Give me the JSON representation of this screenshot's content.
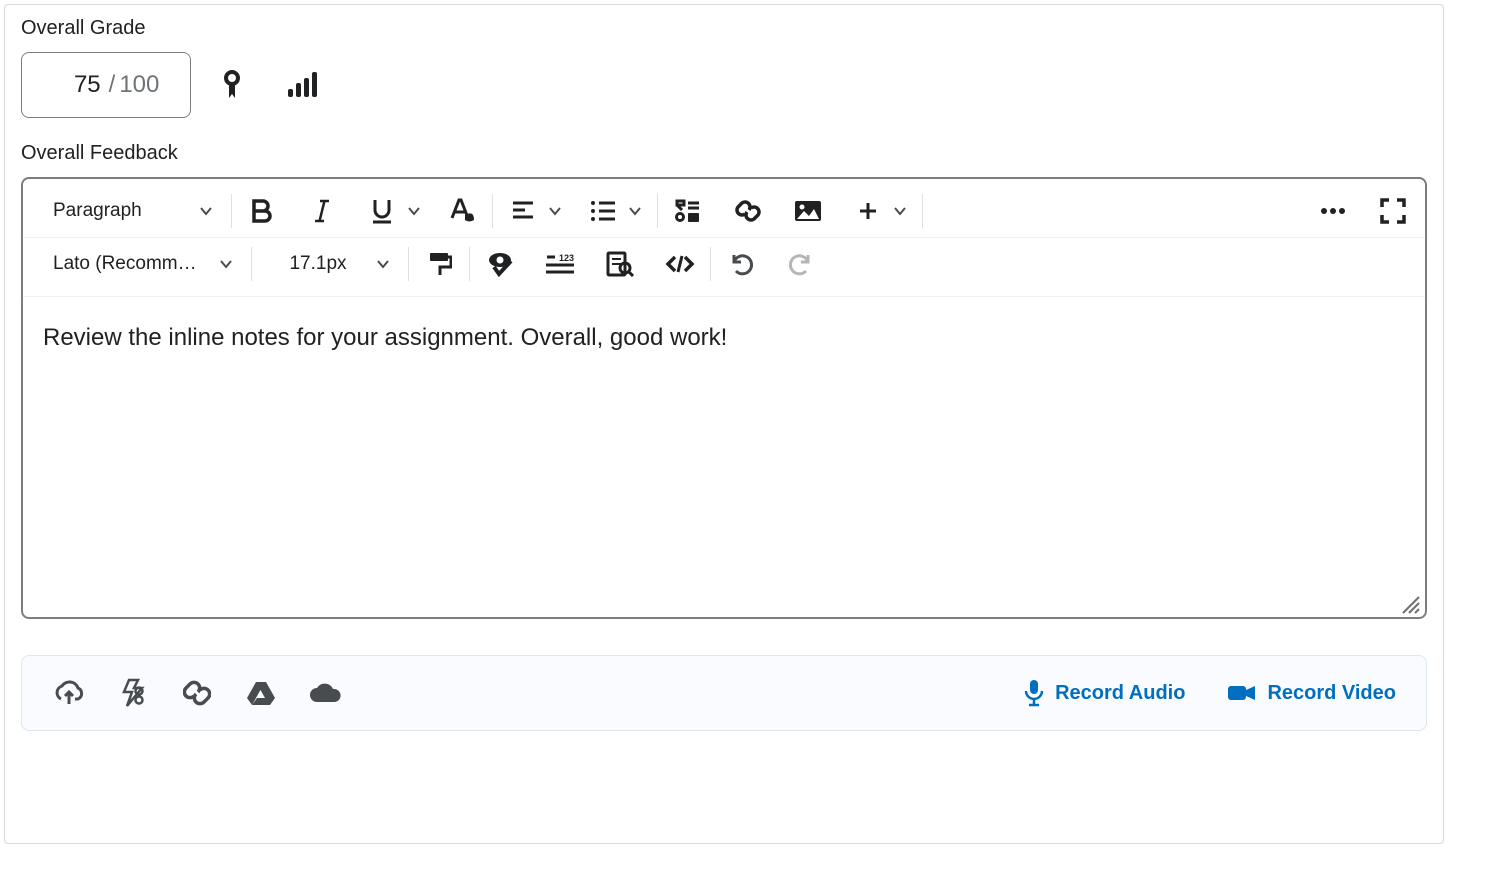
{
  "grade": {
    "label": "Overall Grade",
    "value": "75",
    "separator": "/",
    "max": "100"
  },
  "feedback": {
    "label": "Overall Feedback",
    "content": "Review the inline notes for your assignment. Overall, good work!"
  },
  "toolbar": {
    "format": "Paragraph",
    "font": "Lato (Recomm…",
    "size": "17.1px"
  },
  "record": {
    "audio": "Record Audio",
    "video": "Record Video"
  }
}
